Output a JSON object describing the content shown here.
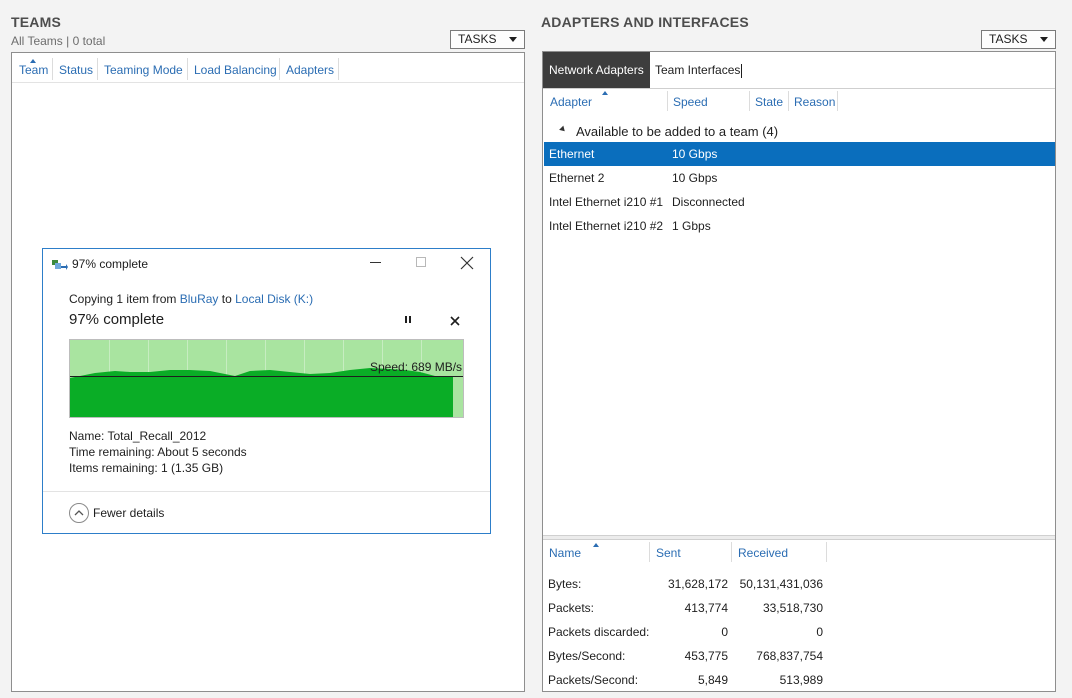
{
  "teams": {
    "title": "TEAMS",
    "subtitle": "All Teams | 0 total",
    "tasks_label": "TASKS",
    "columns": [
      "Team",
      "Status",
      "Teaming Mode",
      "Load Balancing",
      "Adapters"
    ]
  },
  "adapters": {
    "title": "ADAPTERS AND INTERFACES",
    "tasks_label": "TASKS",
    "tabs": [
      "Network Adapters",
      "Team Interfaces"
    ],
    "columns": [
      "Adapter",
      "Speed",
      "State",
      "Reason"
    ],
    "group_label": "Available to be added to a team (4)",
    "rows": [
      {
        "adapter": "Ethernet",
        "speed": "10 Gbps"
      },
      {
        "adapter": "Ethernet 2",
        "speed": "10 Gbps"
      },
      {
        "adapter": "Intel Ethernet i210 #1",
        "speed": "Disconnected"
      },
      {
        "adapter": "Intel Ethernet i210 #2",
        "speed": "1 Gbps"
      }
    ],
    "stats_columns": [
      "Name",
      "Sent",
      "Received"
    ],
    "stats": [
      {
        "name": "Bytes:",
        "sent": "31,628,172",
        "received": "50,131,431,036"
      },
      {
        "name": "Packets:",
        "sent": "413,774",
        "received": "33,518,730"
      },
      {
        "name": "Packets discarded:",
        "sent": "0",
        "received": "0"
      },
      {
        "name": "Bytes/Second:",
        "sent": "453,775",
        "received": "768,837,754"
      },
      {
        "name": "Packets/Second:",
        "sent": "5,849",
        "received": "513,989"
      }
    ]
  },
  "copy_dialog": {
    "title": "97% complete",
    "copy_prefix": "Copying 1 item from",
    "source": "BluRay",
    "to_word": "to",
    "destination": "Local Disk (K:)",
    "progress_text": "97% complete",
    "progress_fraction": 0.97,
    "speed_label": "Speed: 689 MB/s",
    "name_label": "Name:",
    "name_value": "Total_Recall_2012",
    "time_label": "Time remaining:",
    "time_value": "About 5 seconds",
    "items_label": "Items remaining:",
    "items_value": "1 (1.35 GB)",
    "fewer_details": "Fewer details",
    "colors": {
      "fill": "#0aad26",
      "background": "#a9e4a0"
    }
  }
}
